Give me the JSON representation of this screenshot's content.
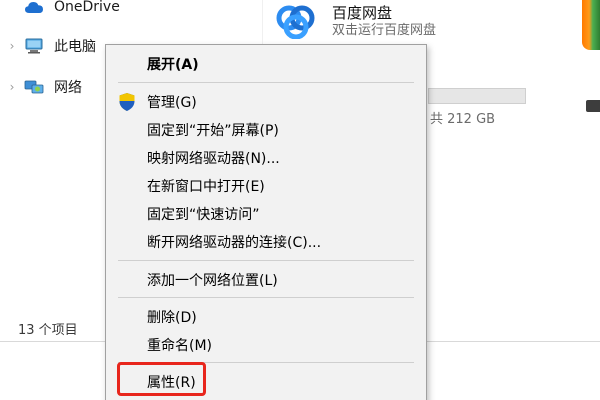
{
  "navigation": {
    "items": [
      {
        "label": "OneDrive",
        "icon": "cloud-icon",
        "has_chevron": false
      },
      {
        "label": "此电脑",
        "icon": "computer-icon",
        "has_chevron": true
      },
      {
        "label": "网络",
        "icon": "network-icon",
        "has_chevron": true
      }
    ]
  },
  "content": {
    "app_tile": {
      "title": "百度网盘",
      "subtitle": "双击运行百度网盘",
      "icon": "baidu-netdisk-icon"
    },
    "drive": {
      "size_text": "共 212 GB"
    }
  },
  "status_bar": {
    "item_count": "13 个项目"
  },
  "context_menu": {
    "items": [
      {
        "label": "展开(A)",
        "bold": true
      },
      {
        "label": "管理(G)",
        "icon": "shield-icon"
      },
      {
        "label": "固定到“开始”屏幕(P)"
      },
      {
        "label": "映射网络驱动器(N)..."
      },
      {
        "label": "在新窗口中打开(E)"
      },
      {
        "label": "固定到“快速访问”"
      },
      {
        "label": "断开网络驱动器的连接(C)..."
      },
      {
        "label": "添加一个网络位置(L)"
      },
      {
        "label": "删除(D)"
      },
      {
        "label": "重命名(M)"
      },
      {
        "label": "属性(R)",
        "highlighted": true
      }
    ]
  },
  "colors": {
    "highlight_border": "#e8261c",
    "menu_background": "#f2f2f2",
    "onedrive_blue": "#1e6fd0"
  }
}
